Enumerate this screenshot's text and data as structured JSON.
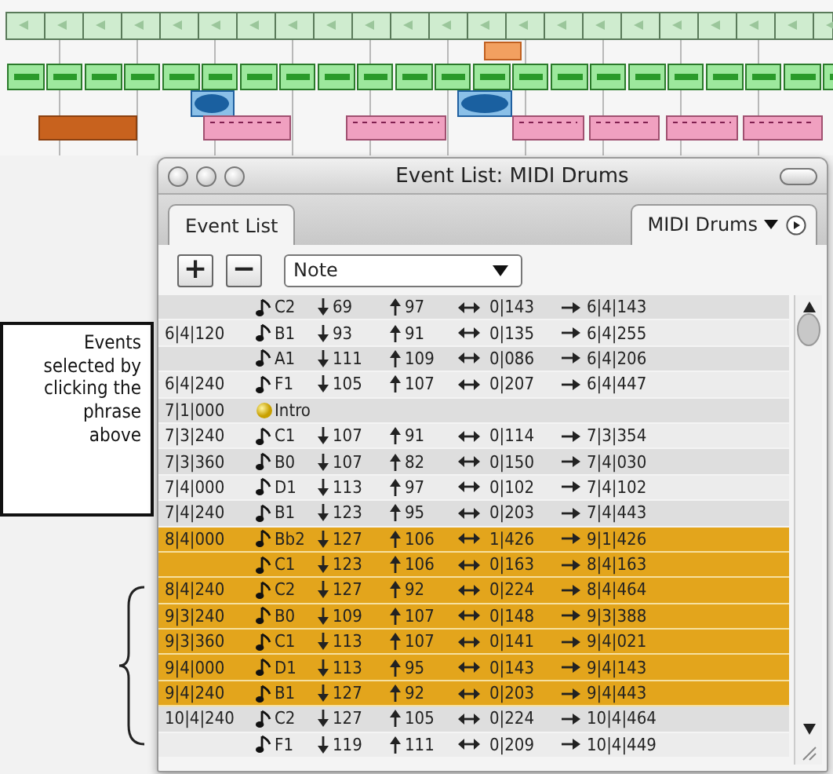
{
  "window": {
    "title": "Event List: MIDI Drums"
  },
  "tabs": [
    {
      "label": "Event List",
      "selected": true
    }
  ],
  "track_menu": {
    "label": "MIDI Drums"
  },
  "toolbar": {
    "add": "+",
    "remove": "−",
    "filter": "Note"
  },
  "events": [
    {
      "kind": "note",
      "note": "C2",
      "velocity": "69",
      "release": "97",
      "length": "0|143",
      "end": "6|4|143",
      "selected": false
    },
    {
      "kind": "note",
      "position": "6|4|120",
      "note": "B1",
      "velocity": "93",
      "release": "91",
      "length": "0|135",
      "end": "6|4|255",
      "selected": false
    },
    {
      "kind": "note",
      "note": "A1",
      "velocity": "111",
      "release": "109",
      "length": "0|086",
      "end": "6|4|206",
      "selected": false
    },
    {
      "kind": "note",
      "position": "6|4|240",
      "note": "F1",
      "velocity": "105",
      "release": "107",
      "length": "0|207",
      "end": "6|4|447",
      "selected": false
    },
    {
      "kind": "marker",
      "position": "7|1|000",
      "note": "Intro",
      "selected": false
    },
    {
      "kind": "note",
      "position": "7|3|240",
      "note": "C1",
      "velocity": "107",
      "release": "91",
      "length": "0|114",
      "end": "7|3|354",
      "selected": false
    },
    {
      "kind": "note",
      "position": "7|3|360",
      "note": "B0",
      "velocity": "107",
      "release": "82",
      "length": "0|150",
      "end": "7|4|030",
      "selected": false
    },
    {
      "kind": "note",
      "position": "7|4|000",
      "note": "D1",
      "velocity": "113",
      "release": "97",
      "length": "0|102",
      "end": "7|4|102",
      "selected": false
    },
    {
      "kind": "note",
      "position": "7|4|240",
      "note": "B1",
      "velocity": "123",
      "release": "95",
      "length": "0|203",
      "end": "7|4|443",
      "selected": false
    },
    {
      "kind": "note",
      "position": "8|4|000",
      "note": "Bb2",
      "velocity": "127",
      "release": "106",
      "length": "1|426",
      "end": "9|1|426",
      "selected": true
    },
    {
      "kind": "note",
      "note": "C1",
      "velocity": "123",
      "release": "106",
      "length": "0|163",
      "end": "8|4|163",
      "selected": true
    },
    {
      "kind": "note",
      "position": "8|4|240",
      "note": "C2",
      "velocity": "127",
      "release": "92",
      "length": "0|224",
      "end": "8|4|464",
      "selected": true
    },
    {
      "kind": "note",
      "position": "9|3|240",
      "note": "B0",
      "velocity": "109",
      "release": "107",
      "length": "0|148",
      "end": "9|3|388",
      "selected": true
    },
    {
      "kind": "note",
      "position": "9|3|360",
      "note": "C1",
      "velocity": "113",
      "release": "107",
      "length": "0|141",
      "end": "9|4|021",
      "selected": true
    },
    {
      "kind": "note",
      "position": "9|4|000",
      "note": "D1",
      "velocity": "113",
      "release": "95",
      "length": "0|143",
      "end": "9|4|143",
      "selected": true
    },
    {
      "kind": "note",
      "position": "9|4|240",
      "note": "B1",
      "velocity": "127",
      "release": "92",
      "length": "0|203",
      "end": "9|4|443",
      "selected": true
    },
    {
      "kind": "note",
      "position": "10|4|240",
      "note": "C2",
      "velocity": "127",
      "release": "105",
      "length": "0|224",
      "end": "10|4|464",
      "selected": false
    },
    {
      "kind": "note",
      "note": "F1",
      "velocity": "119",
      "release": "111",
      "length": "0|209",
      "end": "10|4|449",
      "selected": false
    }
  ],
  "callout": {
    "lines": [
      "Events",
      "selected by",
      "clicking the",
      "phrase",
      "above"
    ]
  }
}
